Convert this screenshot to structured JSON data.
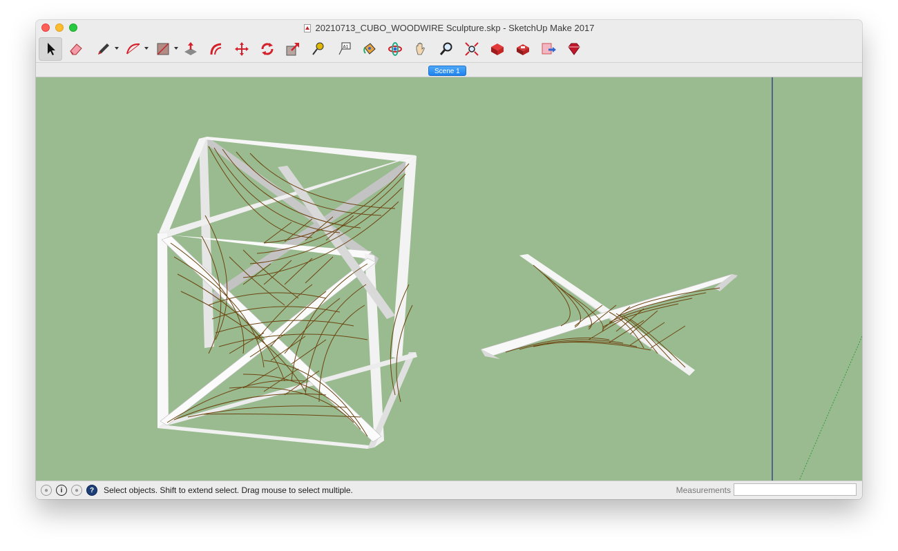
{
  "window": {
    "title": "20210713_CUBO_WOODWIRE Sculpture.skp - SketchUp Make 2017",
    "doc_icon": "skp-file-icon"
  },
  "toolbar": {
    "tools": [
      {
        "name": "select-tool",
        "icon": "arrow-cursor-icon",
        "active": true
      },
      {
        "name": "eraser-tool",
        "icon": "eraser-icon"
      },
      {
        "name": "line-tool",
        "icon": "pencil-icon",
        "has_dropdown": true
      },
      {
        "name": "arc-tool",
        "icon": "arc-icon",
        "has_dropdown": true
      },
      {
        "name": "shape-tool",
        "icon": "rectangle-icon",
        "has_dropdown": true
      },
      {
        "name": "push-pull-tool",
        "icon": "push-pull-icon"
      },
      {
        "name": "offset-tool",
        "icon": "offset-icon"
      },
      {
        "name": "move-tool",
        "icon": "move-icon"
      },
      {
        "name": "rotate-tool",
        "icon": "rotate-icon"
      },
      {
        "name": "scale-tool",
        "icon": "scale-icon"
      },
      {
        "name": "tape-measure-tool",
        "icon": "tape-measure-icon"
      },
      {
        "name": "text-tool",
        "icon": "text-label-icon"
      },
      {
        "name": "paint-bucket-tool",
        "icon": "paint-bucket-icon"
      },
      {
        "name": "orbit-tool",
        "icon": "orbit-icon"
      },
      {
        "name": "pan-tool",
        "icon": "hand-icon"
      },
      {
        "name": "zoom-tool",
        "icon": "magnifier-icon"
      },
      {
        "name": "zoom-extents-tool",
        "icon": "zoom-extents-icon"
      },
      {
        "name": "warehouse-tool",
        "icon": "3d-warehouse-icon"
      },
      {
        "name": "extension-warehouse-tool",
        "icon": "extension-warehouse-icon"
      },
      {
        "name": "send-to-layout-tool",
        "icon": "send-to-layout-icon"
      },
      {
        "name": "extension-manager-tool",
        "icon": "ruby-gem-icon"
      }
    ]
  },
  "scenes": {
    "tabs": [
      "Scene 1"
    ]
  },
  "status": {
    "hint": "Select objects. Shift to extend select. Drag mouse to select multiple.",
    "measurements_label": "Measurements",
    "measurements_value": ""
  },
  "colors": {
    "viewport_bg": "#9abb8f",
    "wire": "#6b4410",
    "frame": "#f4f4f4",
    "frame_shade": "#b9b9b9",
    "scene_tab": "#2a8cf2",
    "blue_axis": "#1c2b8c"
  }
}
